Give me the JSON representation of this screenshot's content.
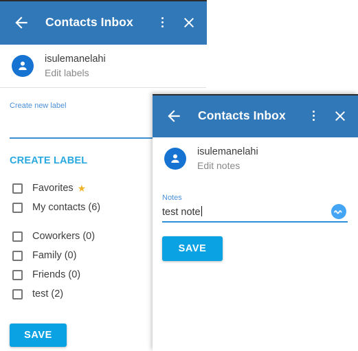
{
  "labels_dialog": {
    "appbar": {
      "title": "Contacts Inbox",
      "back_icon": "arrow-left-icon",
      "menu_icon": "kebab-menu-icon",
      "close_icon": "close-icon",
      "bg_color": "#3178b8"
    },
    "contact": {
      "name": "isulemanelahi",
      "subtitle": "Edit labels",
      "avatar_icon": "person-avatar-icon"
    },
    "new_label_field": {
      "label": "Create new label",
      "value": "",
      "placeholder": ""
    },
    "create_label_link": "CREATE LABEL",
    "labels": [
      {
        "name": "Favorites",
        "count": "",
        "checked": false,
        "star": "★"
      },
      {
        "name": "My contacts (6)",
        "count": "6",
        "checked": false,
        "star": ""
      },
      {
        "name": "Coworkers (0)",
        "count": "0",
        "checked": false,
        "star": ""
      },
      {
        "name": "Family (0)",
        "count": "0",
        "checked": false,
        "star": ""
      },
      {
        "name": "Friends (0)",
        "count": "0",
        "checked": false,
        "star": ""
      },
      {
        "name": "test (2)",
        "count": "2",
        "checked": false,
        "star": ""
      }
    ],
    "save_label": "SAVE"
  },
  "notes_dialog": {
    "appbar": {
      "title": "Contacts Inbox",
      "back_icon": "arrow-left-icon",
      "menu_icon": "kebab-menu-icon",
      "close_icon": "close-icon",
      "bg_color": "#3178b8"
    },
    "contact": {
      "name": "isulemanelahi",
      "subtitle": "Edit notes",
      "avatar_icon": "person-avatar-icon"
    },
    "notes_field": {
      "label": "Notes",
      "value": "test note",
      "placeholder": "",
      "trailing_icon": "wave-circle-icon"
    },
    "save_label": "SAVE"
  },
  "colors": {
    "appbar_blue": "#3178b8",
    "accent_blue": "#0aa2e3",
    "avatar_blue": "#1673d2",
    "underline_blue": "#3d8ed0",
    "star_yellow": "#f0b429"
  }
}
